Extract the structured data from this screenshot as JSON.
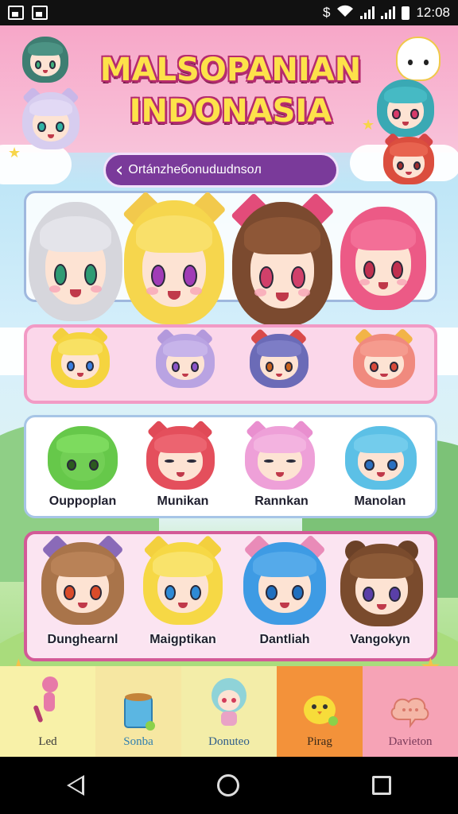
{
  "status_bar": {
    "time": "12:08"
  },
  "header": {
    "title_line1": "MALSOPANIAN",
    "title_line2": "INDONASIA",
    "subtitle": "Ortánzheбonudшdnsoл"
  },
  "row4": {
    "characters": [
      {
        "name": "Dunghearnl"
      },
      {
        "name": "Maigptikan"
      },
      {
        "name": "Dantliah"
      },
      {
        "name": "Vangokyn"
      }
    ]
  },
  "row3": {
    "characters": [
      {
        "name": "Ouppoplan"
      },
      {
        "name": "Munikan"
      },
      {
        "name": "Rannkan"
      },
      {
        "name": "Manolan"
      }
    ]
  },
  "tabs": [
    {
      "label": "Led",
      "icon": "figure-icon",
      "color": "#f8f1a8"
    },
    {
      "label": "Sonba",
      "icon": "paint-bucket-icon",
      "color": "#f6e7a2"
    },
    {
      "label": "Donuteo",
      "icon": "chibi-girl-icon",
      "color": "#f3eda8"
    },
    {
      "label": "Pirag",
      "icon": "chick-icon",
      "color": "#f3923a"
    },
    {
      "label": "Davieton",
      "icon": "speech-cloud-icon",
      "color": "#f6a3b6"
    }
  ]
}
